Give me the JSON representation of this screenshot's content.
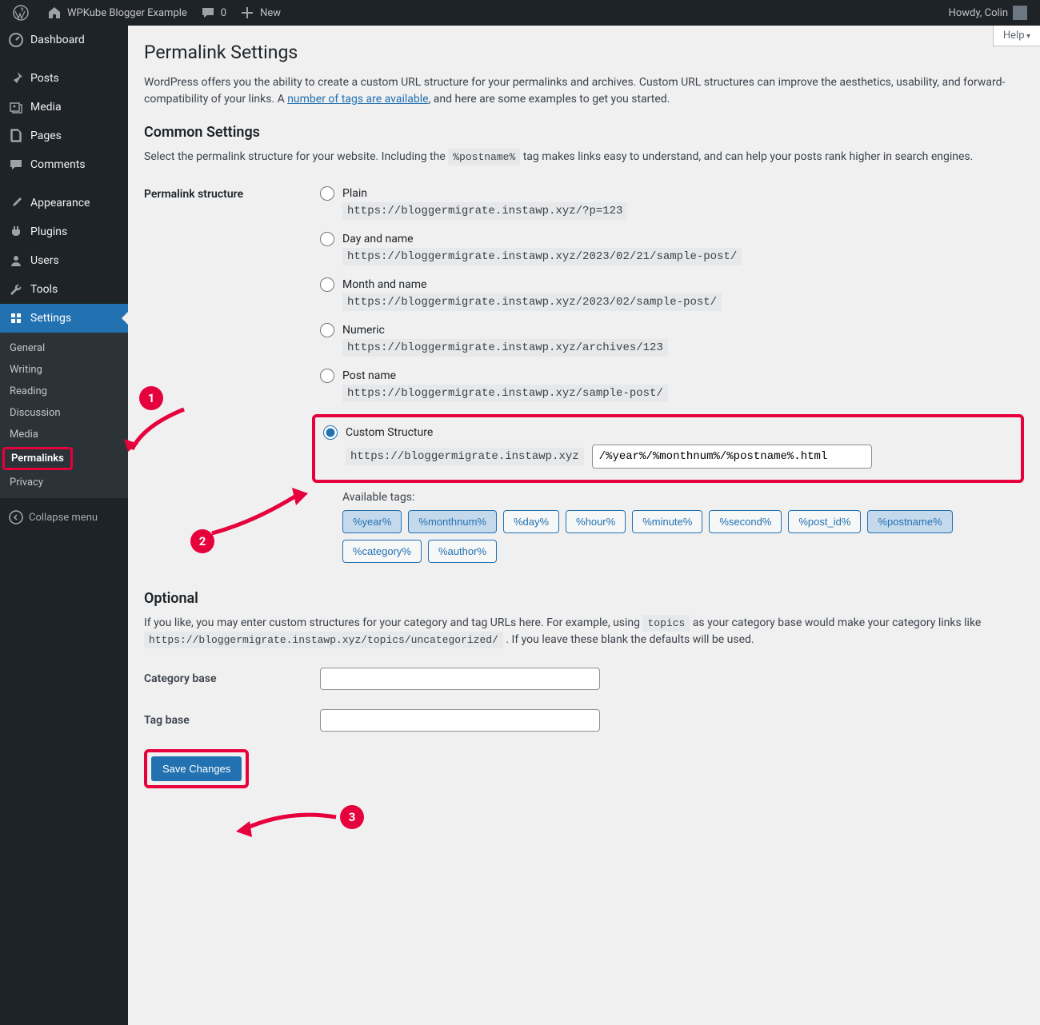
{
  "adminbar": {
    "site_name": "WPKube Blogger Example",
    "comments": "0",
    "new": "New",
    "howdy": "Howdy, Colin"
  },
  "sidebar": {
    "dashboard": "Dashboard",
    "posts": "Posts",
    "media": "Media",
    "pages": "Pages",
    "comments": "Comments",
    "appearance": "Appearance",
    "plugins": "Plugins",
    "users": "Users",
    "tools": "Tools",
    "settings": "Settings",
    "sub": {
      "general": "General",
      "writing": "Writing",
      "reading": "Reading",
      "discussion": "Discussion",
      "media": "Media",
      "permalinks": "Permalinks",
      "privacy": "Privacy"
    },
    "collapse": "Collapse menu"
  },
  "content": {
    "help": "Help",
    "title": "Permalink Settings",
    "intro_a": "WordPress offers you the ability to create a custom URL structure for your permalinks and archives. Custom URL structures can improve the aesthetics, usability, and forward-compatibility of your links. A ",
    "intro_link": "number of tags are available",
    "intro_b": ", and here are some examples to get you started.",
    "h2_common": "Common Settings",
    "common_desc_a": "Select the permalink structure for your website. Including the ",
    "common_tag": "%postname%",
    "common_desc_b": " tag makes links easy to understand, and can help your posts rank higher in search engines.",
    "th_structure": "Permalink structure",
    "opts": {
      "plain": {
        "label": "Plain",
        "url": "https://bloggermigrate.instawp.xyz/?p=123"
      },
      "dayname": {
        "label": "Day and name",
        "url": "https://bloggermigrate.instawp.xyz/2023/02/21/sample-post/"
      },
      "monthname": {
        "label": "Month and name",
        "url": "https://bloggermigrate.instawp.xyz/2023/02/sample-post/"
      },
      "numeric": {
        "label": "Numeric",
        "url": "https://bloggermigrate.instawp.xyz/archives/123"
      },
      "postname": {
        "label": "Post name",
        "url": "https://bloggermigrate.instawp.xyz/sample-post/"
      },
      "custom": {
        "label": "Custom Structure",
        "base": "https://bloggermigrate.instawp.xyz",
        "value": "/%year%/%monthnum%/%postname%.html"
      }
    },
    "available_tags_label": "Available tags:",
    "tags": [
      "%year%",
      "%monthnum%",
      "%day%",
      "%hour%",
      "%minute%",
      "%second%",
      "%post_id%",
      "%postname%",
      "%category%",
      "%author%"
    ],
    "active_tags": [
      "%year%",
      "%monthnum%",
      "%postname%"
    ],
    "h2_optional": "Optional",
    "optional_a": "If you like, you may enter custom structures for your category and tag URLs here. For example, using ",
    "optional_code1": "topics",
    "optional_b": " as your category base would make your category links like ",
    "optional_code2": "https://bloggermigrate.instawp.xyz/topics/uncategorized/",
    "optional_c": " . If you leave these blank the defaults will be used.",
    "cat_base": "Category base",
    "tag_base": "Tag base",
    "save": "Save Changes"
  },
  "annotations": {
    "n1": "1",
    "n2": "2",
    "n3": "3"
  }
}
